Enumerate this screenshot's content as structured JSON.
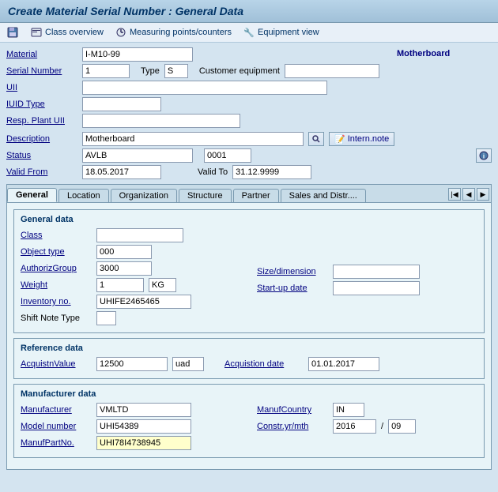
{
  "title": "Create Material Serial Number : General Data",
  "toolbar": {
    "items": [
      {
        "id": "save",
        "label": "",
        "icon": "💾"
      },
      {
        "id": "class-overview",
        "label": "Class overview"
      },
      {
        "id": "measuring",
        "label": "Measuring points/counters"
      },
      {
        "id": "equipment",
        "label": "Equipment view",
        "icon": "🔧"
      }
    ]
  },
  "header": {
    "material_label": "Material",
    "material_value": "I-M10-99",
    "description_right": "Motherboard",
    "serial_number_label": "Serial Number",
    "serial_number_value": "1",
    "type_label": "Type",
    "type_value": "S",
    "customer_equipment_label": "Customer equipment",
    "uii_label": "UII",
    "iuid_type_label": "IUID Type",
    "resp_plant_label": "Resp. Plant UII",
    "description_label": "Description",
    "description_value": "Motherboard",
    "status_label": "Status",
    "status_value": "AVLB",
    "status_code": "0001",
    "valid_from_label": "Valid From",
    "valid_from_value": "18.05.2017",
    "valid_to_label": "Valid To",
    "valid_to_value": "31.12.9999",
    "intern_note_label": "Intern.note"
  },
  "tabs": [
    {
      "id": "general",
      "label": "General",
      "active": true
    },
    {
      "id": "location",
      "label": "Location"
    },
    {
      "id": "organization",
      "label": "Organization"
    },
    {
      "id": "structure",
      "label": "Structure"
    },
    {
      "id": "partner",
      "label": "Partner"
    },
    {
      "id": "sales",
      "label": "Sales and Distr...."
    }
  ],
  "general_data": {
    "section_title": "General data",
    "class_label": "Class",
    "class_value": "",
    "object_type_label": "Object type",
    "object_type_value": "000",
    "authoriz_label": "AuthorizGroup",
    "authoriz_value": "3000",
    "weight_label": "Weight",
    "weight_value": "1",
    "weight_unit": "KG",
    "size_dim_label": "Size/dimension",
    "size_dim_value": "",
    "inventory_label": "Inventory no.",
    "inventory_value": "UHIFE2465465",
    "startup_label": "Start-up date",
    "startup_value": "",
    "shift_note_label": "Shift Note Type",
    "shift_note_value": ""
  },
  "reference_data": {
    "section_title": "Reference data",
    "acquistn_label": "AcquistnValue",
    "acquistn_value": "12500",
    "acquistn_unit": "uad",
    "acquistion_date_label": "Acquistion date",
    "acquistion_date_value": "01.01.2017"
  },
  "manufacturer_data": {
    "section_title": "Manufacturer data",
    "manufacturer_label": "Manufacturer",
    "manufacturer_value": "VMLTD",
    "manuf_country_label": "ManufCountry",
    "manuf_country_value": "IN",
    "model_number_label": "Model number",
    "model_number_value": "UHI54389",
    "constr_yr_label": "Constr.yr/mth",
    "constr_yr_value": "2016",
    "constr_mth_value": "09",
    "manuf_part_label": "ManufPartNo.",
    "manuf_part_value": "UHI78I4738945"
  }
}
